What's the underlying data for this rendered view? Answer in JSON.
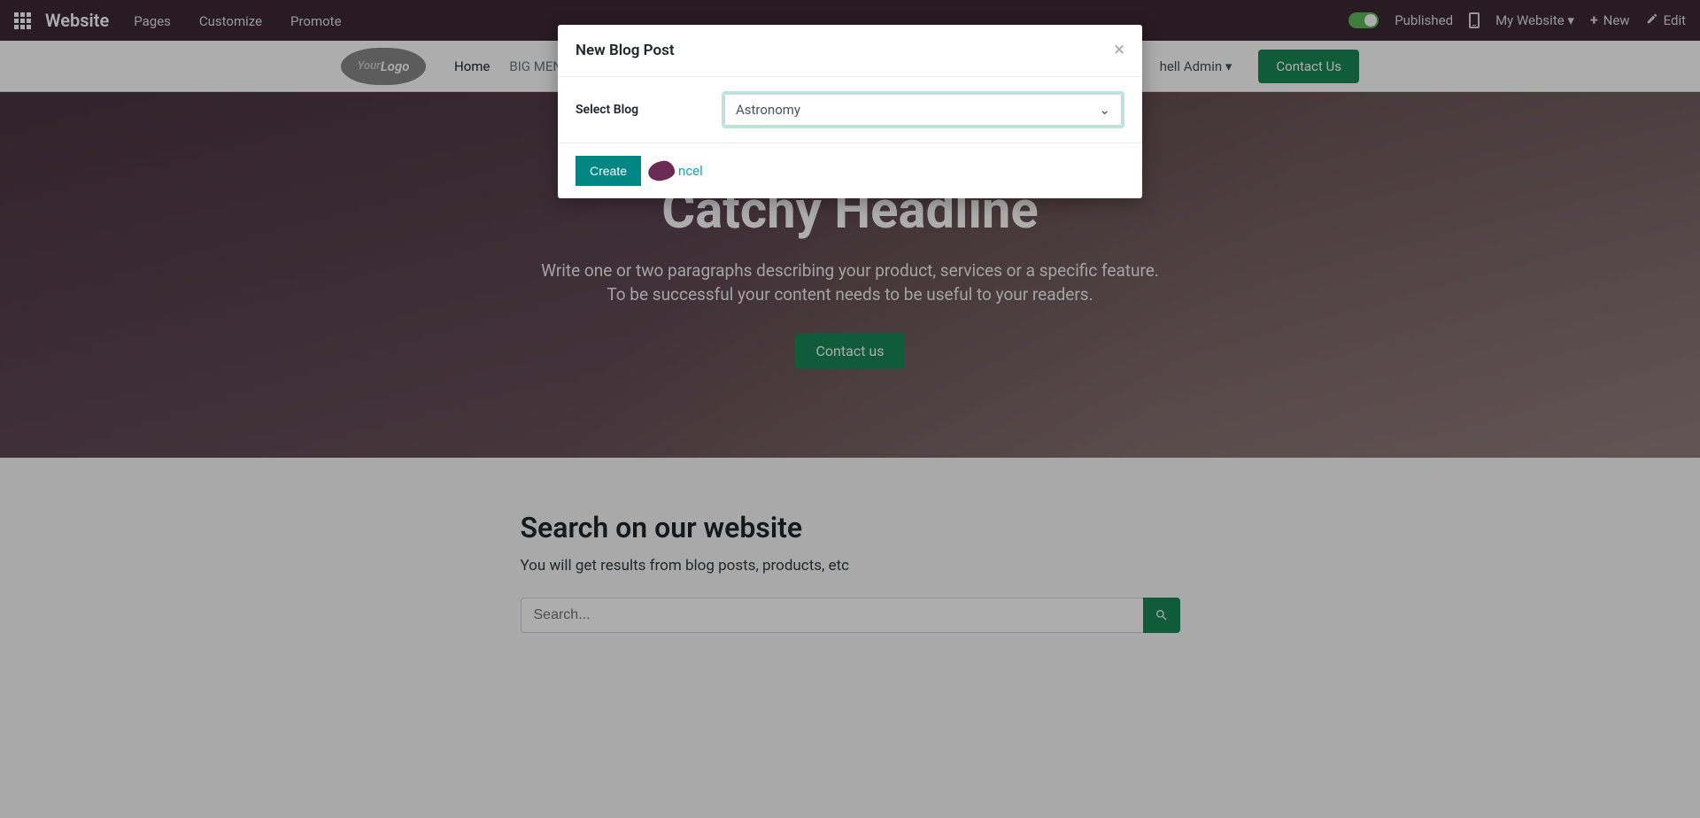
{
  "topbar": {
    "brand": "Website",
    "menu": [
      "Pages",
      "Customize",
      "Promote"
    ],
    "published_label": "Published",
    "website_dropdown": "My Website ▾",
    "new_label": "New",
    "edit_label": "Edit"
  },
  "sitenav": {
    "logo_text_left": "Your",
    "logo_text_right": "Logo",
    "items": [
      {
        "label": "Home",
        "active": true
      },
      {
        "label": "BIG MEN",
        "active": false
      }
    ],
    "admin_label": "hell Admin ▾",
    "contact_us": "Contact Us"
  },
  "hero": {
    "headline": "Catchy Headline",
    "line1": "Write one or two paragraphs describing your product, services or a specific feature.",
    "line2": "To be successful your content needs to be useful to your readers.",
    "cta": "Contact us"
  },
  "search": {
    "title": "Search on our website",
    "subtitle": "You will get results from blog posts, products, etc",
    "placeholder": "Search..."
  },
  "modal": {
    "title": "New Blog Post",
    "field_label": "Select Blog",
    "selected_value": "Astronomy",
    "create_label": "Create",
    "cancel_fragment": "ncel"
  }
}
